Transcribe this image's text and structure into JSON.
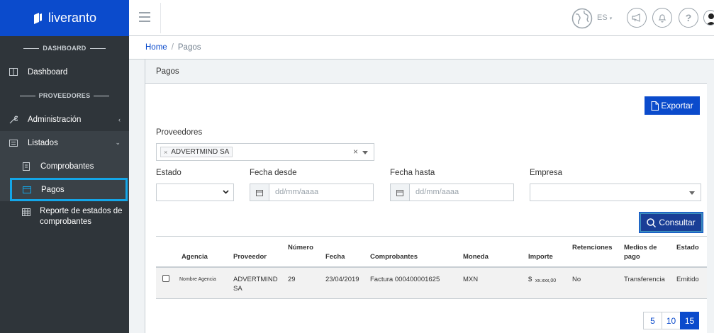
{
  "brand": {
    "name": "liveranto"
  },
  "sidebar": {
    "section_dashboard": "DASHBOARD",
    "dashboard": "Dashboard",
    "section_proveedores": "PROVEEDORES",
    "administracion": "Administración",
    "listados": "Listados",
    "comprobantes": "Comprobantes",
    "pagos": "Pagos",
    "reporte": "Reporte de estados de comprobantes"
  },
  "header": {
    "lang": "ES"
  },
  "breadcrumb": {
    "home": "Home",
    "current": "Pagos"
  },
  "card": {
    "title": "Pagos"
  },
  "toolbar": {
    "export_label": "Exportar",
    "consultar_label": "Consultar"
  },
  "filters": {
    "proveedores_label": "Proveedores",
    "proveedores_tag": "ADVERTMIND SA",
    "estado_label": "Estado",
    "fecha_desde_label": "Fecha desde",
    "fecha_desde_placeholder": "dd/mm/aaaa",
    "fecha_hasta_label": "Fecha hasta",
    "fecha_hasta_placeholder": "dd/mm/aaaa",
    "empresa_label": "Empresa"
  },
  "table": {
    "headers": {
      "agencia": "Agencia",
      "proveedor": "Proveedor",
      "numero": "Número",
      "fecha": "Fecha",
      "comprobantes": "Comprobantes",
      "moneda": "Moneda",
      "importe": "Importe",
      "retenciones": "Retenciones",
      "medios_1": "Medios de",
      "medios_2": "pago",
      "estado": "Estado"
    },
    "rows": [
      {
        "agencia": "Nombre Agencia",
        "proveedor_1": "ADVERTMIND",
        "proveedor_2": "SA",
        "numero": "29",
        "fecha": "23/04/2019",
        "comprobantes": "Factura 000400001625",
        "moneda": "MXN",
        "importe_symbol": "$",
        "importe_value": "xx.xxx,00",
        "retenciones": "No",
        "medios": "Transferencia",
        "estado": "Emitido"
      }
    ]
  },
  "pagination": {
    "p1": "5",
    "p2": "10",
    "p3": "15"
  },
  "colors": {
    "brand": "#0b4bcc",
    "sidebar": "#2f353a",
    "active_border": "#14a6e8"
  }
}
